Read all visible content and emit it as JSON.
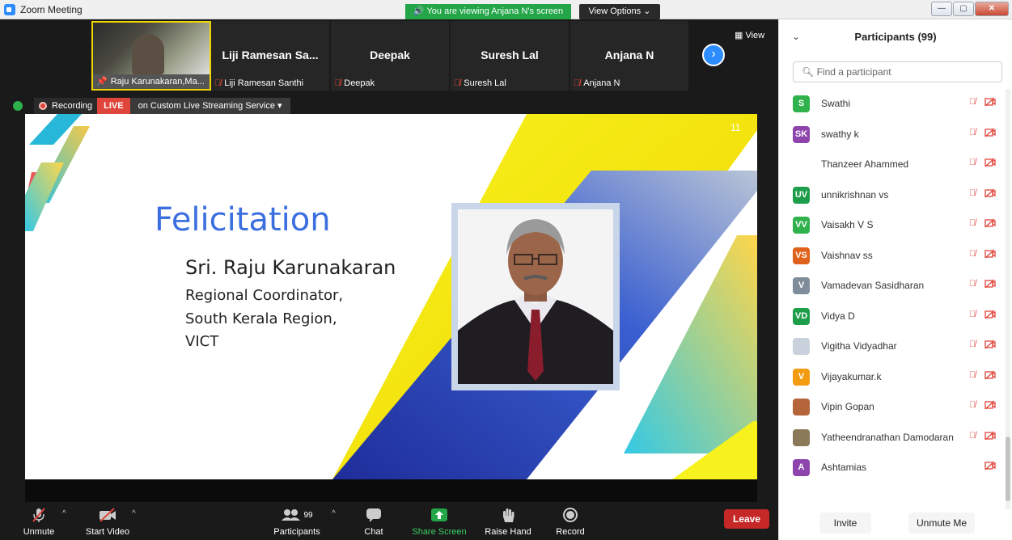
{
  "window": {
    "title": "Zoom Meeting",
    "viewing_banner": "You are viewing Anjana N's screen",
    "view_options": "View Options",
    "controls": [
      "minimize",
      "maximize",
      "close"
    ]
  },
  "thumbnails": [
    {
      "big_name": "",
      "label": "Raju Karunakaran,Ma...",
      "muted": false,
      "active": true
    },
    {
      "big_name": "Liji Ramesan Sa...",
      "label": "Liji Ramesan Santhi",
      "muted": true,
      "active": false
    },
    {
      "big_name": "Deepak",
      "label": "Deepak",
      "muted": true,
      "active": false
    },
    {
      "big_name": "Suresh Lal",
      "label": "Suresh Lal",
      "muted": true,
      "active": false
    },
    {
      "big_name": "Anjana N",
      "label": "Anjana N",
      "muted": true,
      "active": false
    }
  ],
  "view_label": "View",
  "recording": {
    "label": "Recording",
    "live": "LIVE",
    "stream": "on Custom Live Streaming Service"
  },
  "slide": {
    "number": "11",
    "title": "Felicitation",
    "name": "Sri. Raju Karunakaran",
    "lines": [
      "Regional Coordinator,",
      "South Kerala Region,",
      "VICT"
    ]
  },
  "toolbar": {
    "unmute": "Unmute",
    "start_video": "Start Video",
    "participants": "Participants",
    "participants_count": "99",
    "chat": "Chat",
    "share_screen": "Share Screen",
    "raise_hand": "Raise Hand",
    "record": "Record",
    "leave": "Leave"
  },
  "panel": {
    "title": "Participants (99)",
    "search_placeholder": "Find a participant",
    "invite": "Invite",
    "unmute_me": "Unmute Me",
    "participants": [
      {
        "initials": "S",
        "name": "Swathi",
        "color": "#2fb24c",
        "mic_off": true
      },
      {
        "initials": "SK",
        "name": "swathy k",
        "color": "#8e44ad",
        "mic_off": true
      },
      {
        "initials": "",
        "name": "Thanzeer Ahammed",
        "color": "#ffffff",
        "mic_off": true
      },
      {
        "initials": "UV",
        "name": "unnikrishnan vs",
        "color": "#1e9e4a",
        "mic_off": true
      },
      {
        "initials": "VV",
        "name": "Vaisakh V S",
        "color": "#2fb24c",
        "mic_off": true
      },
      {
        "initials": "VS",
        "name": "Vaishnav ss",
        "color": "#e0611b",
        "mic_off": true
      },
      {
        "initials": "V",
        "name": "Vamadevan Sasidharan",
        "color": "#7f8c9a",
        "mic_off": true
      },
      {
        "initials": "VD",
        "name": "Vidya D",
        "color": "#1e9e4a",
        "mic_off": true
      },
      {
        "initials": "",
        "name": "Vigitha Vidyadhar",
        "color": "#c9d2dc",
        "mic_off": true
      },
      {
        "initials": "V",
        "name": "Vijayakumar.k",
        "color": "#f39c12",
        "mic_off": true
      },
      {
        "initials": "",
        "name": "Vipin Gopan",
        "color": "#b5653a",
        "mic_off": true
      },
      {
        "initials": "",
        "name": "Yatheendranathan Damodaran",
        "color": "#8a7a5a",
        "mic_off": true
      },
      {
        "initials": "A",
        "name": "Ashtamias",
        "color": "#8e44ad",
        "mic_off": false
      }
    ]
  }
}
